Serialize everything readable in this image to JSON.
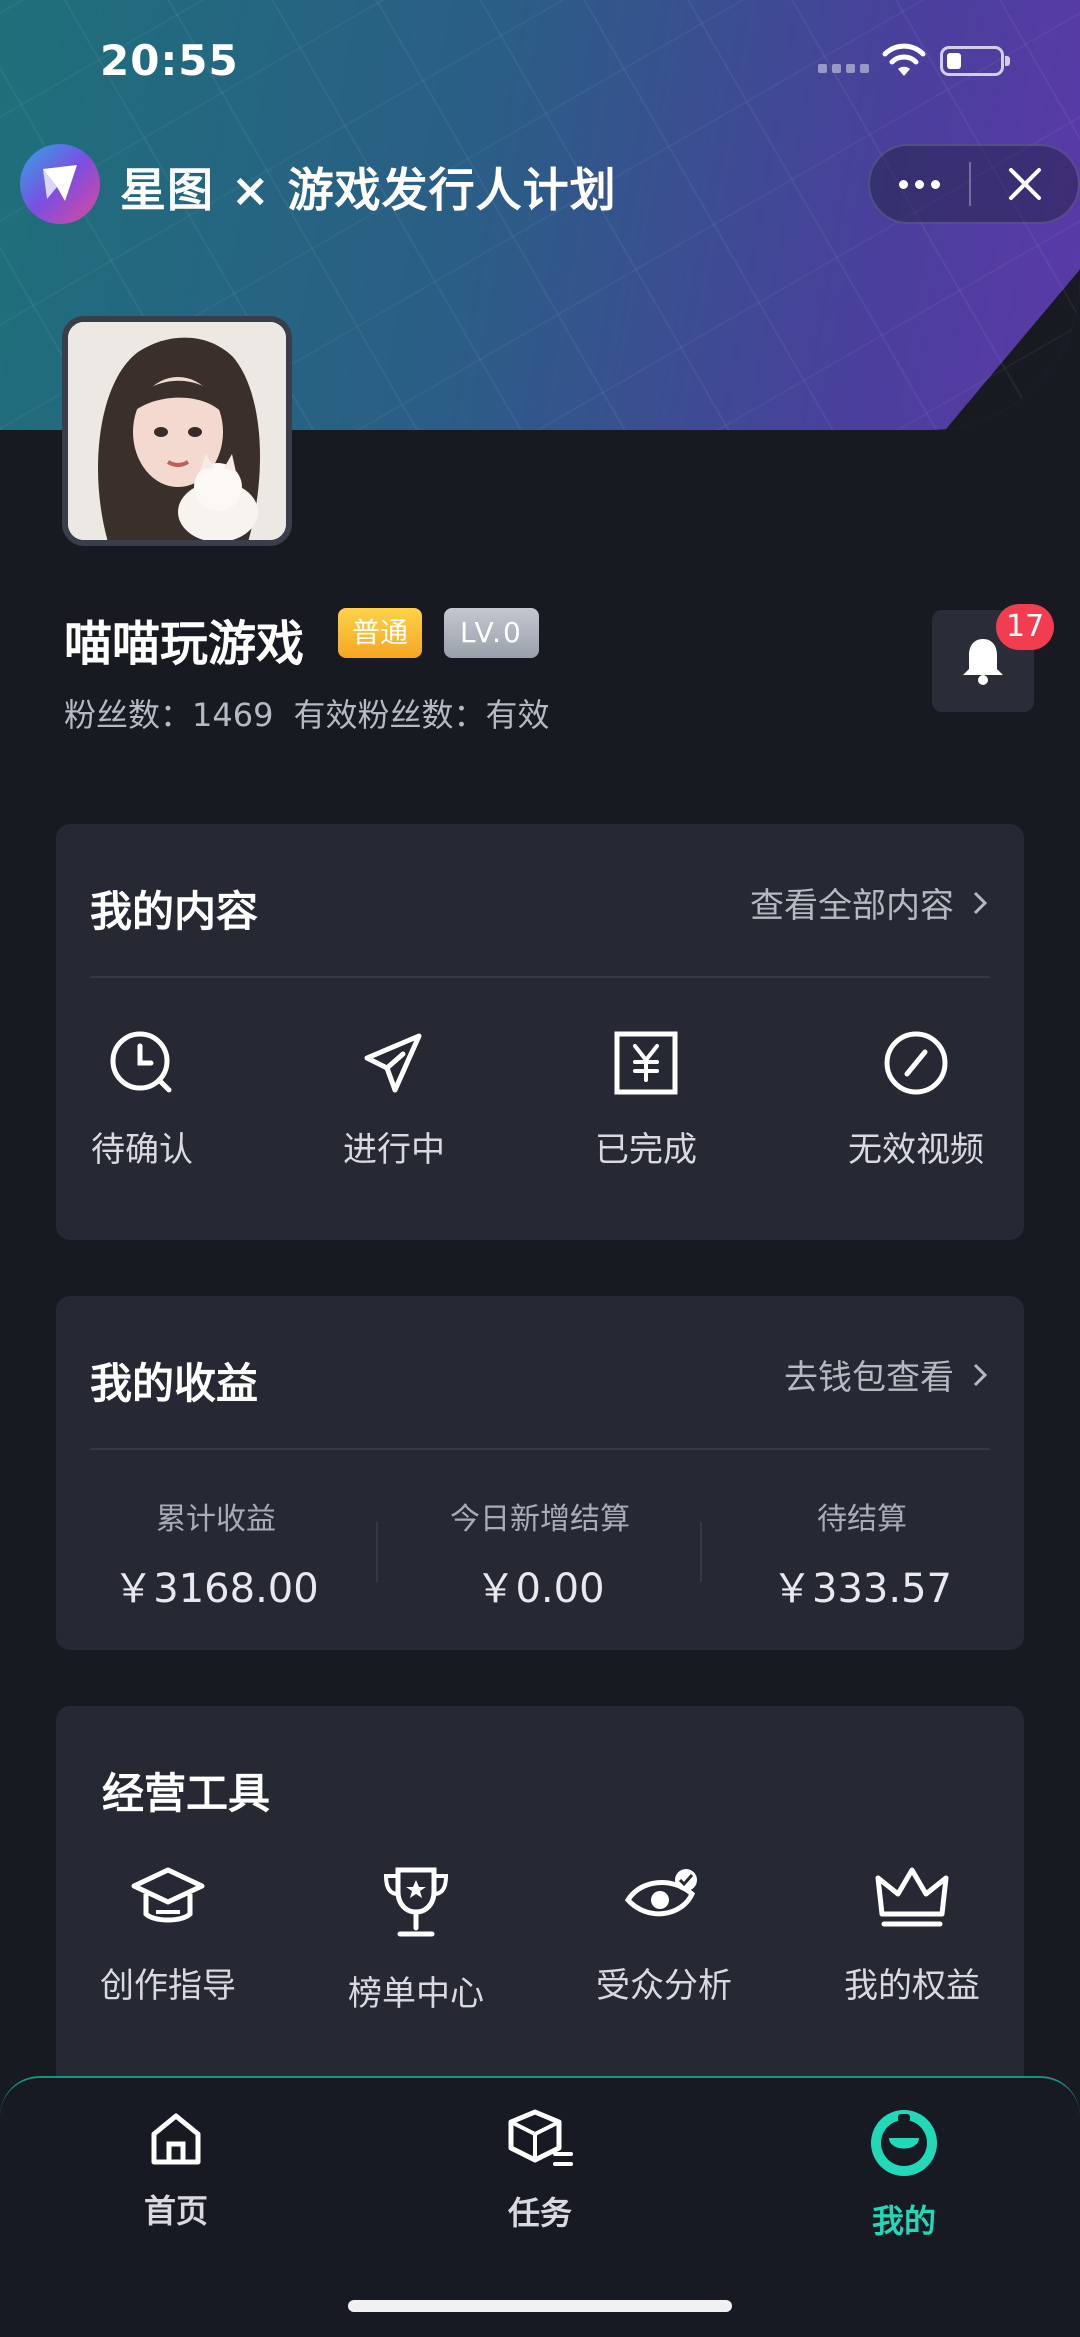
{
  "status_bar": {
    "time": "20:55"
  },
  "app": {
    "title": "星图 × 游戏发行人计划"
  },
  "profile": {
    "nickname": "喵喵玩游戏",
    "badge": "普通",
    "level": "LV.0",
    "fans_label": "粉丝数：1469",
    "valid_fans_label": "有效粉丝数：有效",
    "notification_count": "17"
  },
  "my_content": {
    "title": "我的内容",
    "link": "查看全部内容",
    "items": [
      {
        "label": "待确认",
        "icon": "clock-icon"
      },
      {
        "label": "进行中",
        "icon": "paper-plane-icon"
      },
      {
        "label": "已完成",
        "icon": "yen-box-icon"
      },
      {
        "label": "无效视频",
        "icon": "slash-circle-icon"
      }
    ]
  },
  "earnings": {
    "title": "我的收益",
    "link": "去钱包查看",
    "items": [
      {
        "label": "累计收益",
        "value": "￥3168.00"
      },
      {
        "label": "今日新增结算",
        "value": "￥0.00"
      },
      {
        "label": "待结算",
        "value": "￥333.57"
      }
    ]
  },
  "tools": {
    "title": "经营工具",
    "items": [
      {
        "label": "创作指导",
        "icon": "graduation-cap-icon"
      },
      {
        "label": "榜单中心",
        "icon": "trophy-icon"
      },
      {
        "label": "受众分析",
        "icon": "eye-check-icon"
      },
      {
        "label": "我的权益",
        "icon": "crown-icon"
      }
    ]
  },
  "tabbar": {
    "items": [
      {
        "label": "首页",
        "icon": "home-icon"
      },
      {
        "label": "任务",
        "icon": "task-box-icon"
      },
      {
        "label": "我的",
        "icon": "profile-face-icon"
      }
    ],
    "active_color": "#21d9b8"
  }
}
